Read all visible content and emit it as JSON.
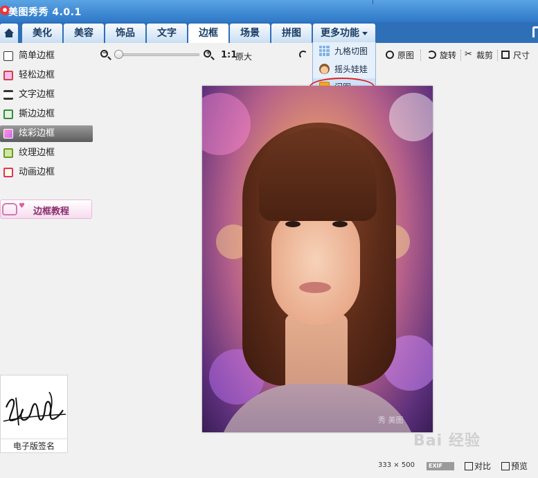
{
  "app": {
    "title": "美图秀秀 4.0.1"
  },
  "nav": {
    "tabs": [
      "美化",
      "美容",
      "饰品",
      "文字",
      "边框",
      "场景",
      "拼图"
    ],
    "active_tab": "边框",
    "more_label": "更多功能"
  },
  "sidebar": {
    "items": [
      "简单边框",
      "轻松边框",
      "文字边框",
      "撕边边框",
      "炫彩边框",
      "纹理边框",
      "动画边框"
    ],
    "selected": "炫彩边框",
    "tutorial_label": "边框教程"
  },
  "toolbar": {
    "ratio_label": "1:1",
    "original_size_label": "原大",
    "original_label": "原图",
    "rotate_label": "旋转",
    "crop_label": "裁剪",
    "size_label": "尺寸"
  },
  "dropdown": {
    "items": [
      "九格切图",
      "摇头娃娃",
      "闪图"
    ],
    "highlighted": "闪图"
  },
  "image": {
    "width": "333",
    "height": "500"
  },
  "status": {
    "dims_separator": "×",
    "exif_label": "EXIF",
    "compare_label": "对比",
    "preview_label": "预览"
  },
  "signature": {
    "caption": "电子版签名"
  },
  "watermark": {
    "text": "Bai 经验",
    "photo_text": "秀 美图"
  },
  "colors": {
    "titlebar": "#3d89d6",
    "navbar": "#2f6fb8",
    "highlight_ellipse": "#e02020",
    "selected_item": "#6e6e6e"
  }
}
